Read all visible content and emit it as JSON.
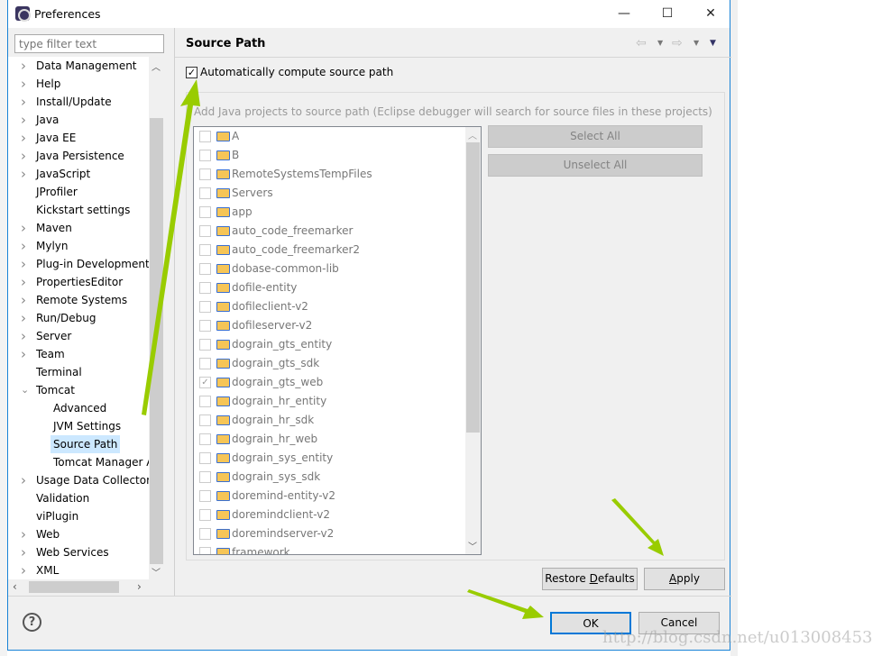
{
  "window": {
    "title": "Preferences",
    "minimize": "—",
    "maximize": "☐",
    "close": "✕"
  },
  "filter": {
    "placeholder": "type filter text"
  },
  "tree": [
    {
      "label": "Data Management",
      "level": 0,
      "expand": "collapsed"
    },
    {
      "label": "Help",
      "level": 0,
      "expand": "collapsed"
    },
    {
      "label": "Install/Update",
      "level": 0,
      "expand": "collapsed"
    },
    {
      "label": "Java",
      "level": 0,
      "expand": "collapsed"
    },
    {
      "label": "Java EE",
      "level": 0,
      "expand": "collapsed"
    },
    {
      "label": "Java Persistence",
      "level": 0,
      "expand": "collapsed"
    },
    {
      "label": "JavaScript",
      "level": 0,
      "expand": "collapsed"
    },
    {
      "label": "JProfiler",
      "level": 0,
      "expand": "none"
    },
    {
      "label": "Kickstart settings",
      "level": 0,
      "expand": "none"
    },
    {
      "label": "Maven",
      "level": 0,
      "expand": "collapsed"
    },
    {
      "label": "Mylyn",
      "level": 0,
      "expand": "collapsed"
    },
    {
      "label": "Plug-in Development",
      "level": 0,
      "expand": "collapsed"
    },
    {
      "label": "PropertiesEditor",
      "level": 0,
      "expand": "collapsed"
    },
    {
      "label": "Remote Systems",
      "level": 0,
      "expand": "collapsed"
    },
    {
      "label": "Run/Debug",
      "level": 0,
      "expand": "collapsed"
    },
    {
      "label": "Server",
      "level": 0,
      "expand": "collapsed"
    },
    {
      "label": "Team",
      "level": 0,
      "expand": "collapsed"
    },
    {
      "label": "Terminal",
      "level": 0,
      "expand": "none"
    },
    {
      "label": "Tomcat",
      "level": 0,
      "expand": "expanded"
    },
    {
      "label": "Advanced",
      "level": 1,
      "expand": "none"
    },
    {
      "label": "JVM Settings",
      "level": 1,
      "expand": "none"
    },
    {
      "label": "Source Path",
      "level": 1,
      "expand": "none",
      "selected": true
    },
    {
      "label": "Tomcat Manager App",
      "level": 1,
      "expand": "none"
    },
    {
      "label": "Usage Data Collector",
      "level": 0,
      "expand": "collapsed"
    },
    {
      "label": "Validation",
      "level": 0,
      "expand": "none"
    },
    {
      "label": "viPlugin",
      "level": 0,
      "expand": "none"
    },
    {
      "label": "Web",
      "level": 0,
      "expand": "collapsed"
    },
    {
      "label": "Web Services",
      "level": 0,
      "expand": "collapsed"
    },
    {
      "label": "XML",
      "level": 0,
      "expand": "collapsed"
    }
  ],
  "page": {
    "title": "Source Path",
    "auto_compute": {
      "label": "Automatically compute source path",
      "checked": true
    },
    "group_label": "Add Java projects to source path (Eclipse debugger will search for source files in these projects)",
    "projects": [
      {
        "name": "A",
        "checked": false
      },
      {
        "name": "B",
        "checked": false
      },
      {
        "name": "RemoteSystemsTempFiles",
        "checked": false
      },
      {
        "name": "Servers",
        "checked": false
      },
      {
        "name": "app",
        "checked": false
      },
      {
        "name": "auto_code_freemarker",
        "checked": false
      },
      {
        "name": "auto_code_freemarker2",
        "checked": false
      },
      {
        "name": "dobase-common-lib",
        "checked": false
      },
      {
        "name": "dofile-entity",
        "checked": false
      },
      {
        "name": "dofileclient-v2",
        "checked": false
      },
      {
        "name": "dofileserver-v2",
        "checked": false
      },
      {
        "name": "dograin_gts_entity",
        "checked": false
      },
      {
        "name": "dograin_gts_sdk",
        "checked": false
      },
      {
        "name": "dograin_gts_web",
        "checked": true
      },
      {
        "name": "dograin_hr_entity",
        "checked": false
      },
      {
        "name": "dograin_hr_sdk",
        "checked": false
      },
      {
        "name": "dograin_hr_web",
        "checked": false
      },
      {
        "name": "dograin_sys_entity",
        "checked": false
      },
      {
        "name": "dograin_sys_sdk",
        "checked": false
      },
      {
        "name": "doremind-entity-v2",
        "checked": false
      },
      {
        "name": "doremindclient-v2",
        "checked": false
      },
      {
        "name": "doremindserver-v2",
        "checked": false
      },
      {
        "name": "framework",
        "checked": false
      }
    ],
    "select_all": "Select All",
    "unselect_all": "Unselect All",
    "restore_pre": "Restore ",
    "restore_u": "D",
    "restore_post": "efaults",
    "apply_u": "A",
    "apply_post": "pply"
  },
  "footer": {
    "help": "?",
    "ok": "OK",
    "cancel": "Cancel"
  },
  "watermark": "http://blog.csdn.net/u013008453",
  "colors": {
    "accent": "#0078d7",
    "arrow": "#99cc00"
  }
}
